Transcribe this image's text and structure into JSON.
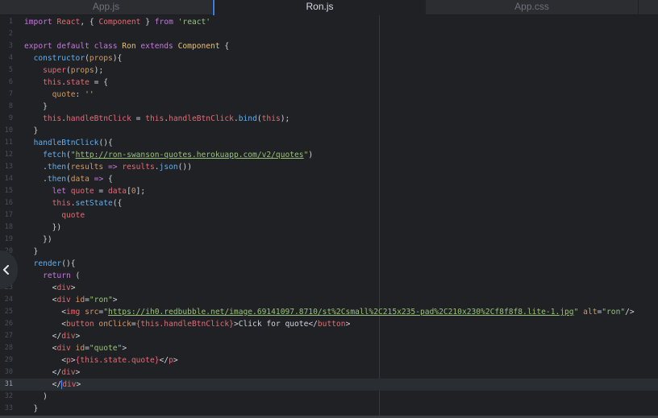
{
  "tabs": [
    {
      "label": "App.js",
      "active": false
    },
    {
      "label": "Ron.js",
      "active": true
    },
    {
      "label": "App.css",
      "active": false
    }
  ],
  "current_line": 31,
  "lines": [
    {
      "n": "1",
      "tokens": [
        [
          "k",
          "import "
        ],
        [
          "t",
          "React"
        ],
        [
          "p",
          ", { "
        ],
        [
          "t",
          "Component"
        ],
        [
          "p",
          " } "
        ],
        [
          "k",
          "from "
        ],
        [
          "s",
          "'react'"
        ]
      ]
    },
    {
      "n": "2",
      "tokens": []
    },
    {
      "n": "3",
      "tokens": [
        [
          "k",
          "export default class "
        ],
        [
          "c",
          "Ron "
        ],
        [
          "k",
          "extends "
        ],
        [
          "c",
          "Component"
        ],
        [
          "p",
          " {"
        ]
      ]
    },
    {
      "n": "4",
      "tokens": [
        [
          "p",
          "  "
        ],
        [
          "f",
          "constructor"
        ],
        [
          "p",
          "("
        ],
        [
          "a",
          "props"
        ],
        [
          "p",
          "){"
        ]
      ]
    },
    {
      "n": "5",
      "tokens": [
        [
          "p",
          "    "
        ],
        [
          "t",
          "super"
        ],
        [
          "p",
          "("
        ],
        [
          "a",
          "props"
        ],
        [
          "p",
          ");"
        ]
      ]
    },
    {
      "n": "6",
      "tokens": [
        [
          "p",
          "    "
        ],
        [
          "t",
          "this"
        ],
        [
          "p",
          "."
        ],
        [
          "t",
          "state"
        ],
        [
          "p",
          " = {"
        ]
      ]
    },
    {
      "n": "7",
      "tokens": [
        [
          "p",
          "      "
        ],
        [
          "a",
          "quote"
        ],
        [
          "p",
          ": "
        ],
        [
          "s",
          "''"
        ]
      ]
    },
    {
      "n": "8",
      "tokens": [
        [
          "p",
          "    }"
        ]
      ]
    },
    {
      "n": "9",
      "tokens": [
        [
          "p",
          "    "
        ],
        [
          "t",
          "this"
        ],
        [
          "p",
          "."
        ],
        [
          "t",
          "handleBtnClick"
        ],
        [
          "p",
          " = "
        ],
        [
          "t",
          "this"
        ],
        [
          "p",
          "."
        ],
        [
          "t",
          "handleBtnClick"
        ],
        [
          "p",
          "."
        ],
        [
          "f",
          "bind"
        ],
        [
          "p",
          "("
        ],
        [
          "t",
          "this"
        ],
        [
          "p",
          ");"
        ]
      ]
    },
    {
      "n": "10",
      "tokens": [
        [
          "p",
          "  }"
        ]
      ]
    },
    {
      "n": "11",
      "tokens": [
        [
          "p",
          "  "
        ],
        [
          "f",
          "handleBtnClick"
        ],
        [
          "p",
          "(){"
        ]
      ]
    },
    {
      "n": "12",
      "tokens": [
        [
          "p",
          "    "
        ],
        [
          "f",
          "fetch"
        ],
        [
          "p",
          "("
        ],
        [
          "s",
          "\""
        ],
        [
          "u",
          "http://ron-swanson-quotes.herokuapp.com/v2/quotes"
        ],
        [
          "s",
          "\""
        ],
        [
          "p",
          ")"
        ]
      ]
    },
    {
      "n": "13",
      "tokens": [
        [
          "p",
          "    ."
        ],
        [
          "f",
          "then"
        ],
        [
          "p",
          "("
        ],
        [
          "a",
          "results "
        ],
        [
          "k",
          "=> "
        ],
        [
          "t",
          "results"
        ],
        [
          "p",
          "."
        ],
        [
          "f",
          "json"
        ],
        [
          "p",
          "())"
        ]
      ]
    },
    {
      "n": "14",
      "tokens": [
        [
          "p",
          "    ."
        ],
        [
          "f",
          "then"
        ],
        [
          "p",
          "("
        ],
        [
          "a",
          "data "
        ],
        [
          "k",
          "=> "
        ],
        [
          "p",
          "{"
        ]
      ]
    },
    {
      "n": "15",
      "tokens": [
        [
          "p",
          "      "
        ],
        [
          "k",
          "let "
        ],
        [
          "t",
          "quote"
        ],
        [
          "p",
          " = "
        ],
        [
          "t",
          "data"
        ],
        [
          "p",
          "["
        ],
        [
          "a",
          "0"
        ],
        [
          "p",
          "];"
        ]
      ]
    },
    {
      "n": "16",
      "tokens": [
        [
          "p",
          "      "
        ],
        [
          "t",
          "this"
        ],
        [
          "p",
          "."
        ],
        [
          "f",
          "setState"
        ],
        [
          "p",
          "({"
        ]
      ]
    },
    {
      "n": "17",
      "tokens": [
        [
          "p",
          "        "
        ],
        [
          "t",
          "quote"
        ]
      ]
    },
    {
      "n": "18",
      "tokens": [
        [
          "p",
          "      })"
        ]
      ]
    },
    {
      "n": "19",
      "tokens": [
        [
          "p",
          "    })"
        ]
      ]
    },
    {
      "n": "20",
      "tokens": [
        [
          "p",
          "  }"
        ]
      ]
    },
    {
      "n": "21",
      "tokens": [
        [
          "p",
          "  "
        ],
        [
          "f",
          "render"
        ],
        [
          "p",
          "(){"
        ]
      ]
    },
    {
      "n": "22",
      "tokens": [
        [
          "p",
          "    "
        ],
        [
          "k",
          "return"
        ],
        [
          "p",
          " ("
        ]
      ]
    },
    {
      "n": "23",
      "tokens": [
        [
          "p",
          "      <"
        ],
        [
          "t",
          "div"
        ],
        [
          "p",
          ">"
        ]
      ]
    },
    {
      "n": "24",
      "tokens": [
        [
          "p",
          "      <"
        ],
        [
          "t",
          "div "
        ],
        [
          "a",
          "id"
        ],
        [
          "p",
          "="
        ],
        [
          "s",
          "\"ron\""
        ],
        [
          "p",
          ">"
        ]
      ]
    },
    {
      "n": "25",
      "tokens": [
        [
          "p",
          "        <"
        ],
        [
          "t",
          "img "
        ],
        [
          "a",
          "src"
        ],
        [
          "p",
          "="
        ],
        [
          "s",
          "\""
        ],
        [
          "u",
          "https://ih0.redbubble.net/image.69141097.8710/st%2Csmall%2C215x235-pad%2C210x230%2Cf8f8f8.lite-1.jpg"
        ],
        [
          "s",
          "\" "
        ],
        [
          "a",
          "alt"
        ],
        [
          "p",
          "="
        ],
        [
          "s",
          "\"ron\""
        ],
        [
          "p",
          "/>"
        ]
      ]
    },
    {
      "n": "26",
      "tokens": [
        [
          "p",
          "        <"
        ],
        [
          "t",
          "button "
        ],
        [
          "a",
          "onClick"
        ],
        [
          "p",
          "="
        ],
        [
          "t",
          "{this.handleBtnClick}"
        ],
        [
          "p",
          ">Click for quote</"
        ],
        [
          "t",
          "button"
        ],
        [
          "p",
          ">"
        ]
      ]
    },
    {
      "n": "27",
      "tokens": [
        [
          "p",
          "      </"
        ],
        [
          "t",
          "div"
        ],
        [
          "p",
          ">"
        ]
      ]
    },
    {
      "n": "28",
      "tokens": [
        [
          "p",
          "      <"
        ],
        [
          "t",
          "div "
        ],
        [
          "a",
          "id"
        ],
        [
          "p",
          "="
        ],
        [
          "s",
          "\"quote\""
        ],
        [
          "p",
          ">"
        ]
      ]
    },
    {
      "n": "29",
      "tokens": [
        [
          "p",
          "        <"
        ],
        [
          "t",
          "p"
        ],
        [
          "p",
          ">"
        ],
        [
          "t",
          "{this.state.quote}"
        ],
        [
          "p",
          "</"
        ],
        [
          "t",
          "p"
        ],
        [
          "p",
          ">"
        ]
      ]
    },
    {
      "n": "30",
      "tokens": [
        [
          "p",
          "      </"
        ],
        [
          "t",
          "div"
        ],
        [
          "p",
          ">"
        ]
      ]
    },
    {
      "n": "31",
      "tokens": [
        [
          "p",
          "      </"
        ],
        [
          "cur",
          ""
        ],
        [
          "t",
          "div"
        ],
        [
          "p",
          ">"
        ]
      ]
    },
    {
      "n": "32",
      "tokens": [
        [
          "p",
          "    )"
        ]
      ]
    },
    {
      "n": "33",
      "tokens": [
        [
          "p",
          "  }"
        ]
      ]
    }
  ],
  "icons": {
    "collapse": "chevron-left-icon"
  }
}
